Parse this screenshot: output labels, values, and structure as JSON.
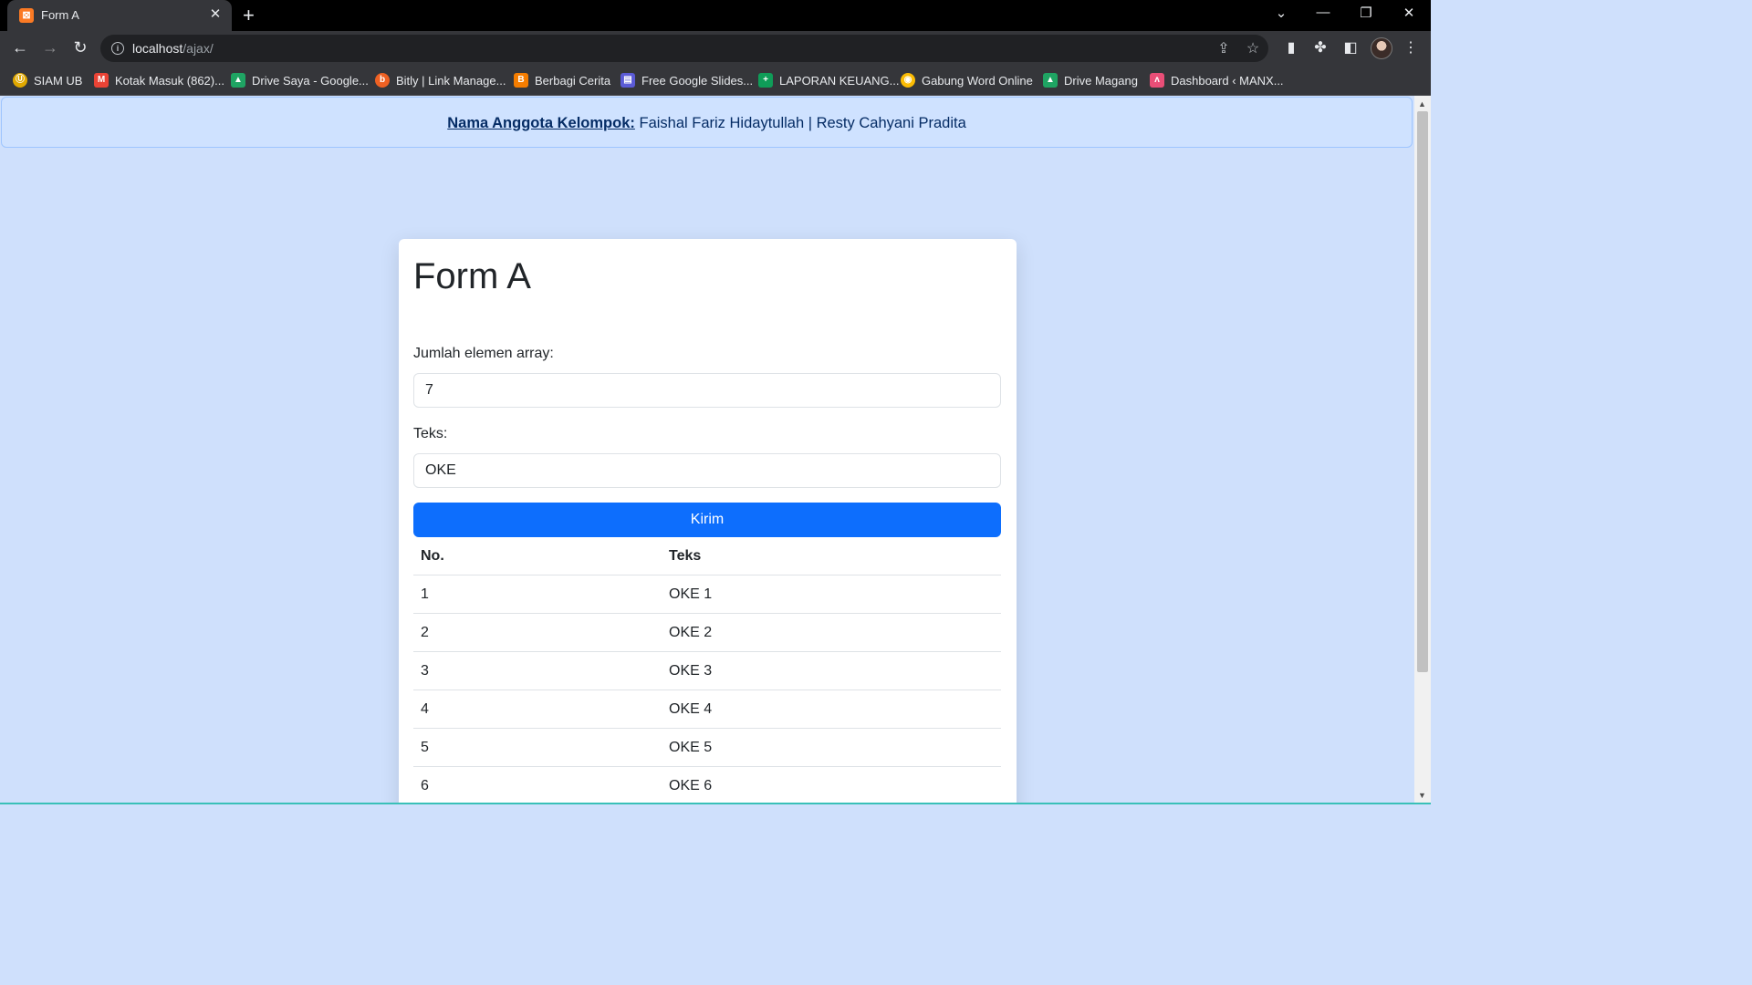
{
  "browser": {
    "tab_title": "Form A",
    "tab_favicon": "xampp-icon",
    "url_host": "localhost",
    "url_path": "/ajax/",
    "bookmarks": [
      {
        "label": "SIAM UB",
        "icon": "siam-icon",
        "color": "#e0a800"
      },
      {
        "label": "Kotak Masuk (862)...",
        "icon": "gmail-icon",
        "color": "#ea4335"
      },
      {
        "label": "Drive Saya - Google...",
        "icon": "drive-icon",
        "color": "#1fa463"
      },
      {
        "label": "Bitly | Link Manage...",
        "icon": "bitly-icon",
        "color": "#ee6123"
      },
      {
        "label": "Berbagi Cerita",
        "icon": "blogger-icon",
        "color": "#f57d00"
      },
      {
        "label": "Free Google Slides...",
        "icon": "slides-icon",
        "color": "#5b5bd6"
      },
      {
        "label": "LAPORAN KEUANG...",
        "icon": "sheets-icon",
        "color": "#0f9d58"
      },
      {
        "label": "Gabung Word Online",
        "icon": "chrome-icon",
        "color": "#fbbc04"
      },
      {
        "label": "Drive Magang",
        "icon": "drive-icon",
        "color": "#1fa463"
      },
      {
        "label": "Dashboard ‹ MANX...",
        "icon": "manx-icon",
        "color": "#e94e77"
      }
    ]
  },
  "alert": {
    "label": "Nama Anggota Kelompok:",
    "members": "Faishal Fariz Hidaytullah | Resty Cahyani Pradita"
  },
  "form": {
    "title": "Form A",
    "count_label": "Jumlah elemen array:",
    "count_value": "7",
    "text_label": "Teks:",
    "text_value": "OKE",
    "submit_label": "Kirim"
  },
  "table": {
    "headers": [
      "No.",
      "Teks"
    ],
    "rows": [
      [
        "1",
        "OKE 1"
      ],
      [
        "2",
        "OKE 2"
      ],
      [
        "3",
        "OKE 3"
      ],
      [
        "4",
        "OKE 4"
      ],
      [
        "5",
        "OKE 5"
      ],
      [
        "6",
        "OKE 6"
      ]
    ]
  },
  "colors": {
    "page_bg": "#cfe0fc",
    "primary_button": "#0d6efd",
    "alert_bg": "#cfe2ff",
    "alert_text": "#052c65"
  }
}
